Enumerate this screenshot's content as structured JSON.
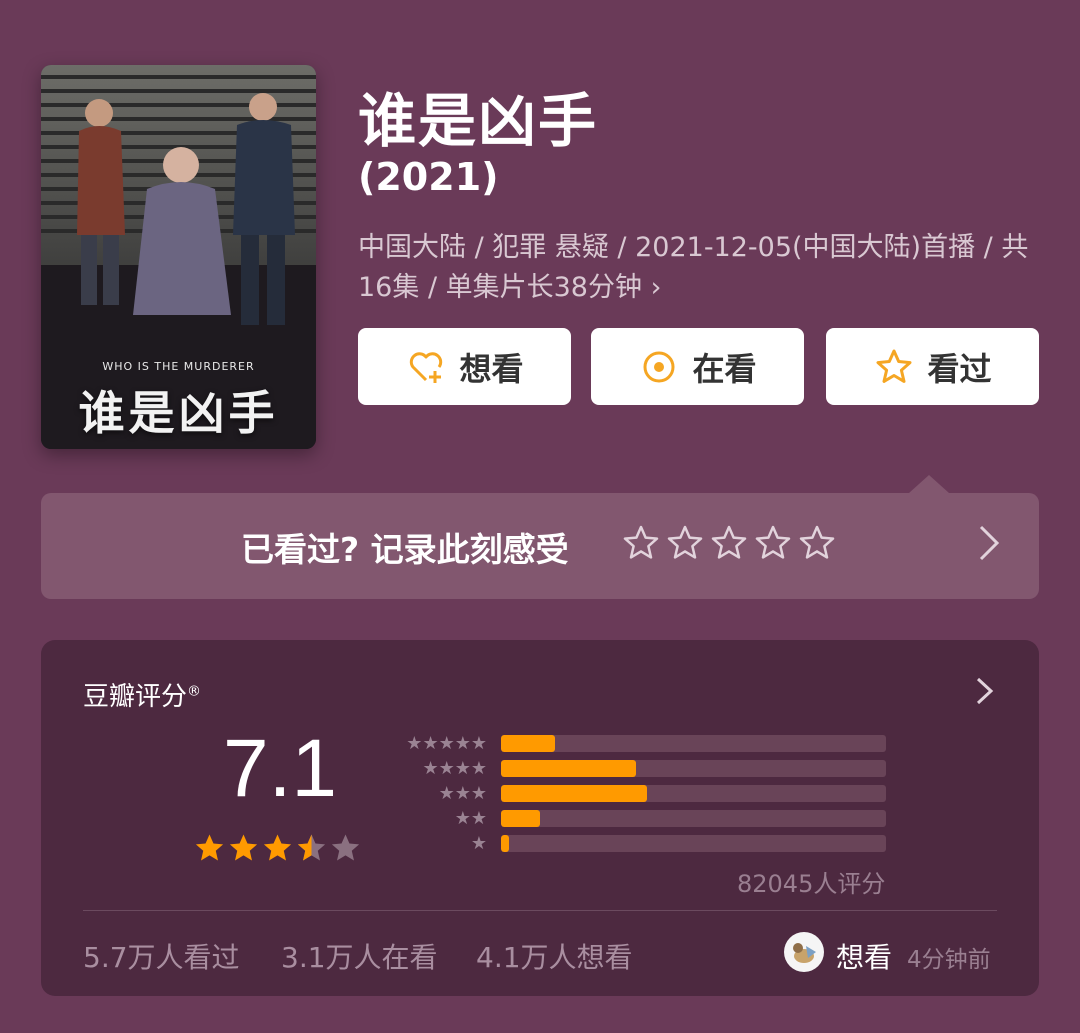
{
  "poster": {
    "subtitle": "WHO IS THE MURDERER",
    "title": "谁是凶手"
  },
  "title": "谁是凶手",
  "year": "(2021)",
  "meta": {
    "line": "中国大陆 / 犯罪 悬疑 / 2021-12-05(中国大陆)首播 / 共16集 / 单集片长38分钟",
    "chevron": "›"
  },
  "actions": [
    {
      "label": "想看",
      "icon": "heart-plus-icon"
    },
    {
      "label": "在看",
      "icon": "target-icon"
    },
    {
      "label": "看过",
      "icon": "star-outline-icon"
    }
  ],
  "callout": {
    "text": "已看过? 记录此刻感受",
    "stars": 5
  },
  "rating": {
    "label": "豆瓣评分",
    "reg": "®",
    "score": "7.1",
    "stars_value": 3.5,
    "distribution": [
      {
        "stars": 5,
        "fraction": 0.14
      },
      {
        "stars": 4,
        "fraction": 0.35
      },
      {
        "stars": 3,
        "fraction": 0.38
      },
      {
        "stars": 2,
        "fraction": 0.1
      },
      {
        "stars": 1,
        "fraction": 0.02
      }
    ],
    "count": "82045人评分"
  },
  "stats": {
    "watched": "5.7万人看过",
    "watching": "3.1万人在看",
    "want": "4.1万人想看"
  },
  "friend": {
    "action": "想看",
    "time": "4分钟前"
  },
  "colors": {
    "background": "#6a3a58",
    "accent": "#ff9a00",
    "icon_orange": "#f5a623"
  }
}
